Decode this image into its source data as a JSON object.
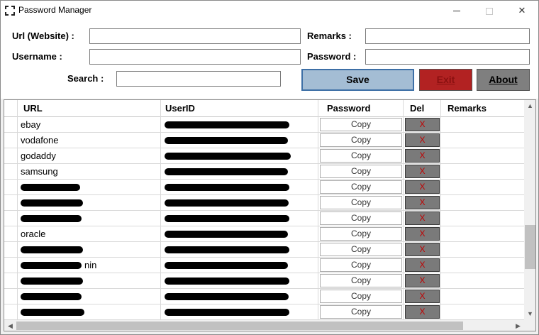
{
  "window": {
    "title": "Password Manager"
  },
  "form": {
    "url_label": "Url (Website) :",
    "username_label": "Username :",
    "search_label": "Search :",
    "remarks_label": "Remarks :",
    "password_label": "Password :",
    "url_value": "",
    "username_value": "",
    "search_value": "",
    "remarks_value": "",
    "password_value": ""
  },
  "buttons": {
    "save": "Save",
    "exit": "Exit",
    "about": "About"
  },
  "grid": {
    "columns": {
      "url": "URL",
      "userid": "UserID",
      "password": "Password",
      "del": "Del",
      "remarks": "Remarks"
    },
    "copy_label": "Copy",
    "del_label": "X",
    "rows": [
      {
        "url": "ebay",
        "url_redacted": false,
        "url_suffix": "",
        "remarks": ""
      },
      {
        "url": "vodafone",
        "url_redacted": false,
        "url_suffix": "",
        "remarks": ""
      },
      {
        "url": "godaddy",
        "url_redacted": false,
        "url_suffix": "",
        "remarks": ""
      },
      {
        "url": "samsung",
        "url_redacted": false,
        "url_suffix": "",
        "remarks": ""
      },
      {
        "url": "",
        "url_redacted": true,
        "url_suffix": "",
        "remarks": ""
      },
      {
        "url": "",
        "url_redacted": true,
        "url_suffix": "",
        "remarks": ""
      },
      {
        "url": "",
        "url_redacted": true,
        "url_suffix": "",
        "remarks": ""
      },
      {
        "url": "oracle",
        "url_redacted": false,
        "url_suffix": "",
        "remarks": ""
      },
      {
        "url": "",
        "url_redacted": true,
        "url_suffix": "",
        "remarks": ""
      },
      {
        "url": "",
        "url_redacted": true,
        "url_suffix": "nin",
        "remarks": ""
      },
      {
        "url": "",
        "url_redacted": true,
        "url_suffix": "",
        "remarks": ""
      },
      {
        "url": "",
        "url_redacted": true,
        "url_suffix": "",
        "remarks": ""
      },
      {
        "url": "",
        "url_redacted": true,
        "url_suffix": "",
        "remarks": ""
      }
    ]
  },
  "colors": {
    "save_bg": "#a4bdd4",
    "exit_bg": "#b22222",
    "about_bg": "#7f7f7f",
    "del_bg": "#7a7a7a",
    "del_x": "#c00000"
  },
  "icons": {
    "app": "focus-frame-icon",
    "minimize": "minimize-icon",
    "maximize": "maximize-icon",
    "close": "close-icon",
    "scroll_up": "arrow-up-icon",
    "scroll_down": "arrow-down-icon",
    "scroll_left": "arrow-left-icon",
    "scroll_right": "arrow-right-icon"
  }
}
